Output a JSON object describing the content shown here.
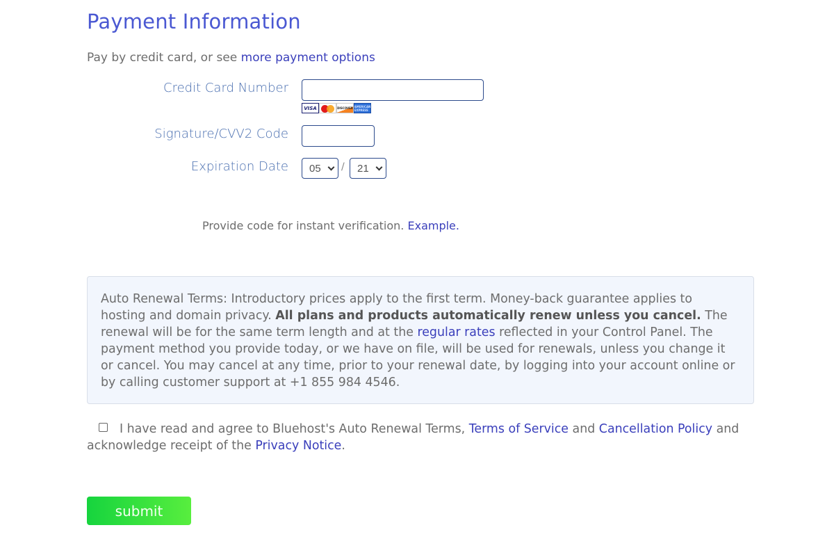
{
  "header": {
    "title": "Payment Information",
    "subtitle_prefix": "Pay by credit card, or see ",
    "subtitle_link": "more payment options"
  },
  "form": {
    "credit_card": {
      "label": "Credit Card Number",
      "value": ""
    },
    "card_logos": [
      "VISA",
      "MasterCard",
      "DISCOVER",
      "AMERICAN EXPRESS"
    ],
    "cvv": {
      "label": "Signature/CVV2 Code",
      "value": ""
    },
    "expiration": {
      "label": "Expiration Date",
      "month": "05",
      "year": "21",
      "separator": "/"
    },
    "verification_text": "Provide code for instant verification. ",
    "verification_link": "Example."
  },
  "terms": {
    "part1": "Auto Renewal Terms: Introductory prices apply to the first term. Money-back guarantee applies to hosting and domain privacy. ",
    "bold": "All plans and products automatically renew unless you cancel.",
    "part2": " The renewal will be for the same term length and at the ",
    "link": "regular rates",
    "part3": " reflected in your Control Panel. The payment method you provide today, or we have on file, will be used for renewals, unless you change it or cancel. You may cancel at any time, prior to your renewal date, by logging into your account online or by calling customer support at +1 855 984 4546."
  },
  "agreement": {
    "checked": false,
    "text1": "I have read and agree to Bluehost's Auto Renewal Terms, ",
    "link_tos": "Terms of Service",
    "text2": " and ",
    "link_cancel": "Cancellation Policy",
    "text3": " and acknowledge receipt of the ",
    "link_privacy": "Privacy Notice",
    "text4": "."
  },
  "submit_label": "submit"
}
